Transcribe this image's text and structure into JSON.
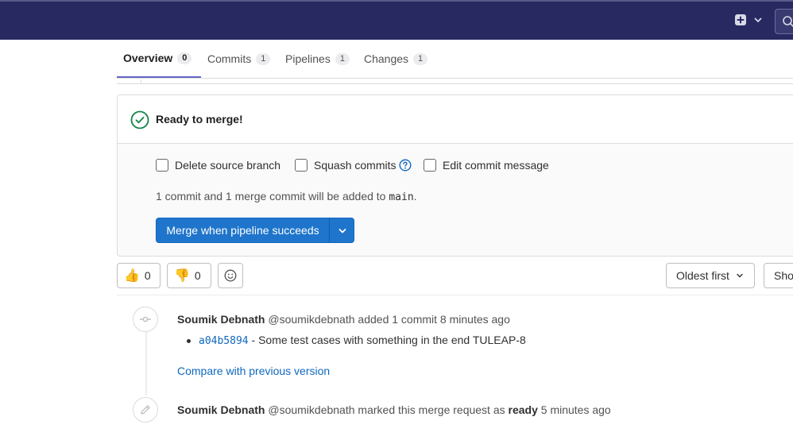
{
  "topbar": {
    "plus_icon": "plus-square-icon",
    "chevron_icon": "chevron-down-icon",
    "search_icon": "search-icon"
  },
  "tabs": [
    {
      "label": "Overview",
      "count": "0",
      "active": true
    },
    {
      "label": "Commits",
      "count": "1",
      "active": false
    },
    {
      "label": "Pipelines",
      "count": "1",
      "active": false
    },
    {
      "label": "Changes",
      "count": "1",
      "active": false
    }
  ],
  "mr_widget": {
    "status": "Ready to merge!",
    "options": {
      "delete_source": "Delete source branch",
      "squash": "Squash commits",
      "edit_message": "Edit commit message"
    },
    "info_prefix": "1 commit and 1 merge commit will be added to ",
    "branch": "main",
    "info_suffix": ".",
    "merge_button": "Merge when pipeline succeeds",
    "colors": {
      "success": "#108548",
      "primary": "#1f75cb"
    }
  },
  "reactions": {
    "thumbs_up": "0",
    "thumbs_down": "0"
  },
  "sort": {
    "label": "Oldest first",
    "show_label": "Show"
  },
  "activity": [
    {
      "author": "Soumik Debnath",
      "handle": "@soumikdebnath",
      "action": "added 1 commit",
      "time": "8 minutes ago",
      "commit_sha": "a04b5894",
      "commit_title": " - Some test cases with something in the end TULEAP-8",
      "compare_link": "Compare with previous version"
    },
    {
      "author": "Soumik Debnath",
      "handle": "@soumikdebnath",
      "action_prefix": "marked this merge request as",
      "action_bold": "ready",
      "time": "5 minutes ago"
    }
  ]
}
